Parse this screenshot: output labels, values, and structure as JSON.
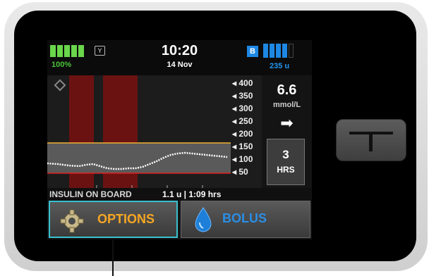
{
  "status_bar": {
    "battery_percent": "100%",
    "battery_level": 1.0,
    "signal_icon": "antenna-icon",
    "time": "10:20",
    "date": "14 Nov",
    "bluetooth_badge": "B",
    "insulin_units": "235 u"
  },
  "graph": {
    "y_ticks": [
      "400",
      "350",
      "300",
      "250",
      "200",
      "150",
      "100",
      "50"
    ],
    "high_target_color": "#f0b030",
    "low_target_color": "#e02020",
    "trace_color": "#ffffff"
  },
  "cgm": {
    "value": "6.6",
    "unit": "mmol/L",
    "trend_arrow": "➡",
    "range_hours": "3",
    "range_label": "HRS"
  },
  "insulin_on_board": {
    "label": "INSULIN ON BOARD",
    "value": "1.1 u | 1:09 hrs"
  },
  "buttons": {
    "options_label": "OPTIONS",
    "bolus_label": "BOLUS"
  },
  "colors": {
    "options_text": "#f5a623",
    "bolus_text": "#2a8ee6",
    "focus_outline": "#38c0cc",
    "battery": "#6ad64b"
  }
}
